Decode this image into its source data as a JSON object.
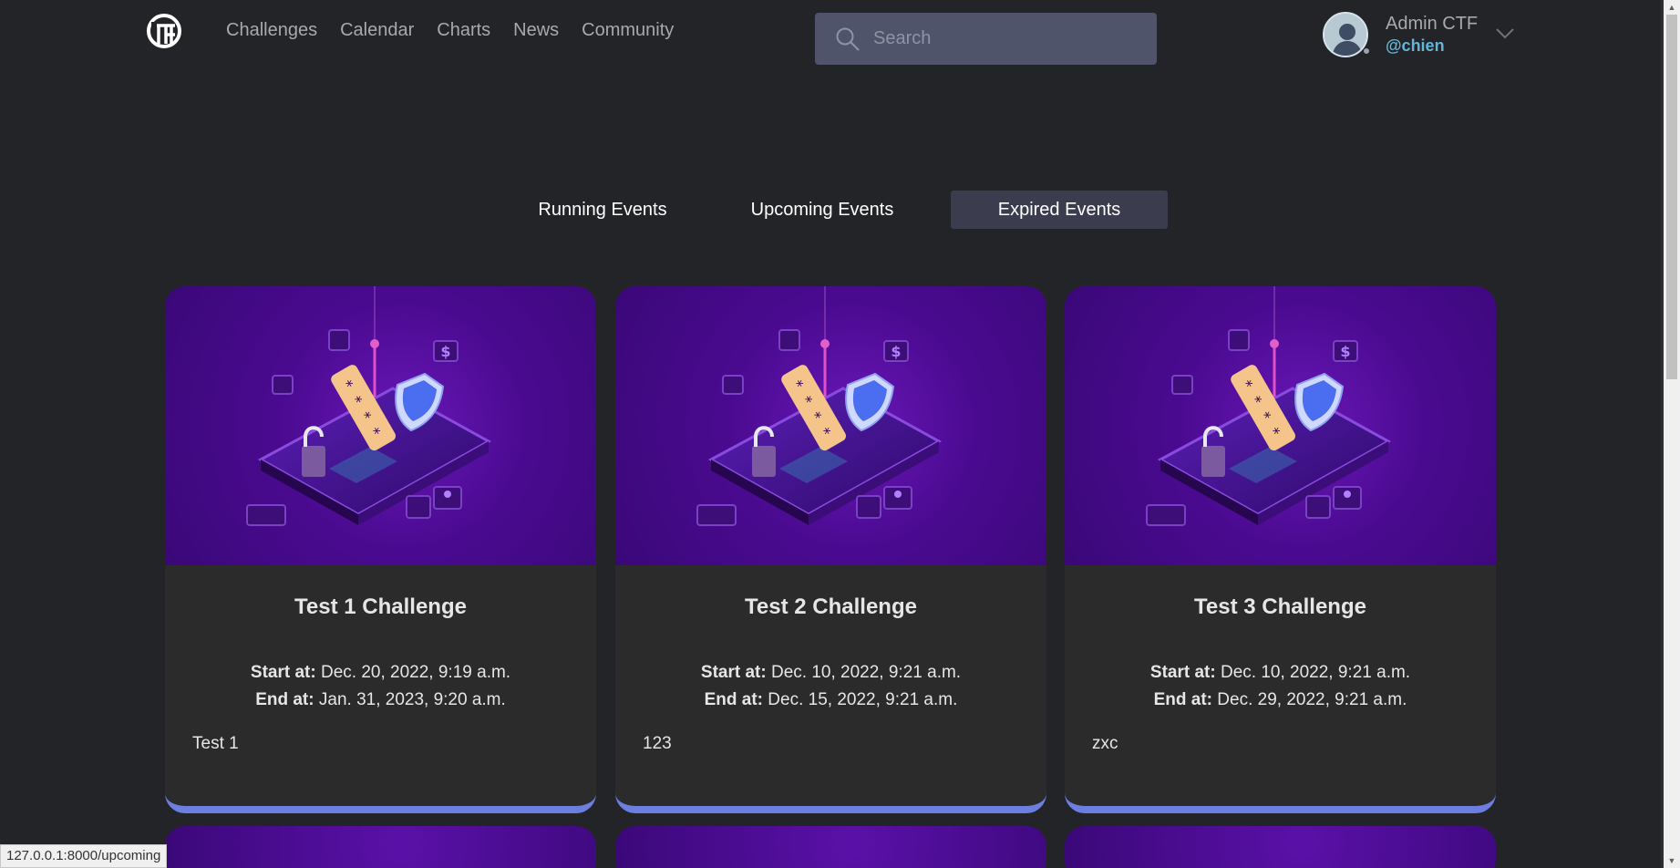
{
  "nav": {
    "items": [
      {
        "label": "Challenges"
      },
      {
        "label": "Calendar"
      },
      {
        "label": "Charts"
      },
      {
        "label": "News"
      },
      {
        "label": "Community"
      }
    ]
  },
  "search": {
    "placeholder": "Search",
    "value": ""
  },
  "user": {
    "name": "Admin CTF",
    "handle": "@chien"
  },
  "tabs": {
    "running": "Running Events",
    "upcoming": "Upcoming Events",
    "expired": "Expired Events",
    "active": "Expired Events"
  },
  "cards": [
    {
      "title": "Test 1 Challenge",
      "start_label": "Start at:",
      "start": "Dec. 20, 2022, 9:19 a.m.",
      "end_label": "End at:",
      "end": "Jan. 31, 2023, 9:20 a.m.",
      "description": "Test 1"
    },
    {
      "title": "Test 2 Challenge",
      "start_label": "Start at:",
      "start": "Dec. 10, 2022, 9:21 a.m.",
      "end_label": "End at:",
      "end": "Dec. 15, 2022, 9:21 a.m.",
      "description": "123"
    },
    {
      "title": "Test 3 Challenge",
      "start_label": "Start at:",
      "start": "Dec. 10, 2022, 9:21 a.m.",
      "end_label": "End at:",
      "end": "Dec. 29, 2022, 9:21 a.m.",
      "description": "zxc"
    }
  ],
  "statusbar": {
    "url": "127.0.0.1:8000/upcoming"
  },
  "colors": {
    "background": "#222427",
    "accent": "#6c7fe0",
    "handle": "#64b5d9",
    "card_bg": "#2b2b2b",
    "active_tab": "#3b3d4f",
    "image_purple": "#4a0a90"
  },
  "icons": {
    "logo": "ctf-logo-icon",
    "search": "search-icon",
    "chevron": "chevron-down-icon",
    "avatar": "user-avatar-icon"
  }
}
